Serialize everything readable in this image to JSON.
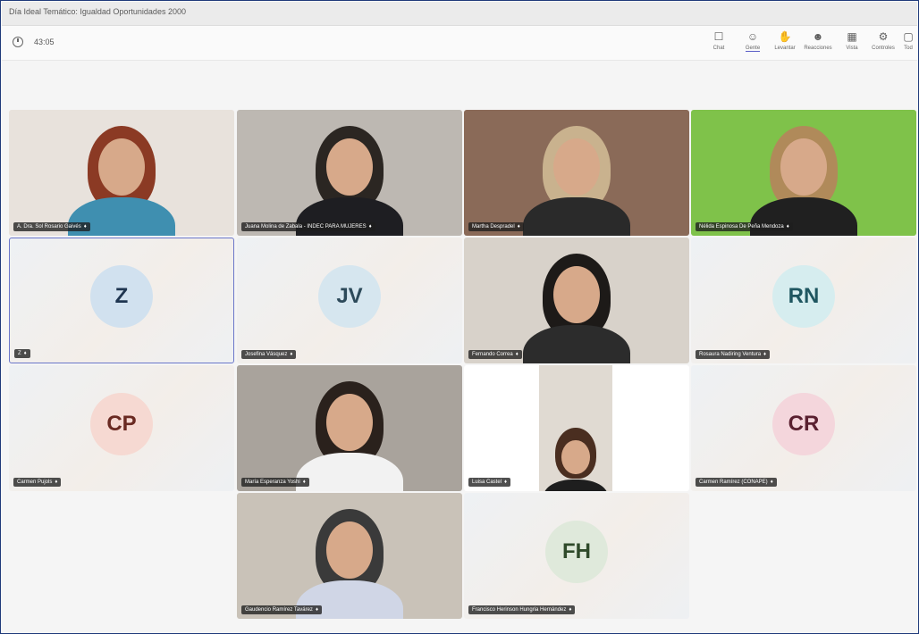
{
  "window": {
    "title": "Día Ideal Temático: Igualdad Oportunidades 2000"
  },
  "toolbar": {
    "timer": "43:05",
    "buttons": [
      {
        "label": "Chat",
        "icon": "chat-icon",
        "glyph": "☐"
      },
      {
        "label": "Gente",
        "icon": "people-icon",
        "glyph": "☺"
      },
      {
        "label": "Levantar",
        "icon": "raise-hand-icon",
        "glyph": "✋"
      },
      {
        "label": "Reacciones",
        "icon": "reactions-icon",
        "glyph": "☻"
      },
      {
        "label": "Vista",
        "icon": "view-icon",
        "glyph": "▦"
      },
      {
        "label": "Controles",
        "icon": "controls-icon",
        "glyph": "⚙"
      },
      {
        "label": "Tod",
        "icon": "more-icon",
        "glyph": "▢"
      }
    ]
  },
  "participants": [
    {
      "name": "A. Dra. Sol Rosario Gaivés",
      "type": "video",
      "colors": {
        "bg": "#e8e2dc",
        "hair": "#8b3a24",
        "shirt": "#3f8fb0"
      }
    },
    {
      "name": "Juana Molina de Zabala - INDEC PARA MUJERES",
      "type": "video",
      "colors": {
        "bg": "#bdb8b2",
        "hair": "#2b2622",
        "shirt": "#1e1e22"
      }
    },
    {
      "name": "Martha Despradel",
      "type": "video",
      "colors": {
        "bg": "#8a6a58",
        "hair": "#c9b28e",
        "shirt": "#2a2a2a"
      }
    },
    {
      "name": "Nélida Espinosa De Peña Mendoza",
      "type": "video",
      "colors": {
        "bg": "#7fc24a",
        "hair": "#b08a5a",
        "shirt": "#202020"
      }
    },
    {
      "name": "Z",
      "type": "avatar",
      "initials": "Z",
      "colors": {
        "avatar_bg": "#d1e1ef",
        "avatar_fg": "#1f3550"
      }
    },
    {
      "name": "Josefina Vásquez",
      "type": "avatar",
      "initials": "JV",
      "colors": {
        "avatar_bg": "#d6e6ef",
        "avatar_fg": "#2d4a5a"
      }
    },
    {
      "name": "Fernando Correa",
      "type": "video",
      "colors": {
        "bg": "#d8d2ca",
        "hair": "#1d1a18",
        "shirt": "#2c2c2c"
      }
    },
    {
      "name": "Rosaura Nadiring Ventura",
      "type": "avatar",
      "initials": "RN",
      "colors": {
        "avatar_bg": "#d6edef",
        "avatar_fg": "#1f5660"
      }
    },
    {
      "name": "Carmen Pujols",
      "type": "avatar",
      "initials": "CP",
      "colors": {
        "avatar_bg": "#f6d9d2",
        "avatar_fg": "#6a2a22"
      }
    },
    {
      "name": "María Esperanza Yoshi",
      "type": "video",
      "colors": {
        "bg": "#a9a39c",
        "hair": "#2a211c",
        "shirt": "#f2f2f2"
      }
    },
    {
      "name": "Luisa Castel",
      "type": "video",
      "colors": {
        "bg": "#e0dad2",
        "hair": "#4a2e20",
        "shirt": "#1e1e1e"
      }
    },
    {
      "name": "Carmen Ramírez (CONAPE)",
      "type": "avatar",
      "initials": "CR",
      "colors": {
        "avatar_bg": "#f4d6dc",
        "avatar_fg": "#5a2030"
      }
    },
    {
      "name": "Gaudencio Ramírez Tavárez",
      "type": "video",
      "colors": {
        "bg": "#c9c2b8",
        "hair": "#3a3a3a",
        "shirt": "#d0d6e6"
      }
    },
    {
      "name": "Francisco Herinson Hungria Hernández",
      "type": "avatar",
      "initials": "FH",
      "colors": {
        "avatar_bg": "#dfe9db",
        "avatar_fg": "#2f4a2a"
      }
    }
  ]
}
